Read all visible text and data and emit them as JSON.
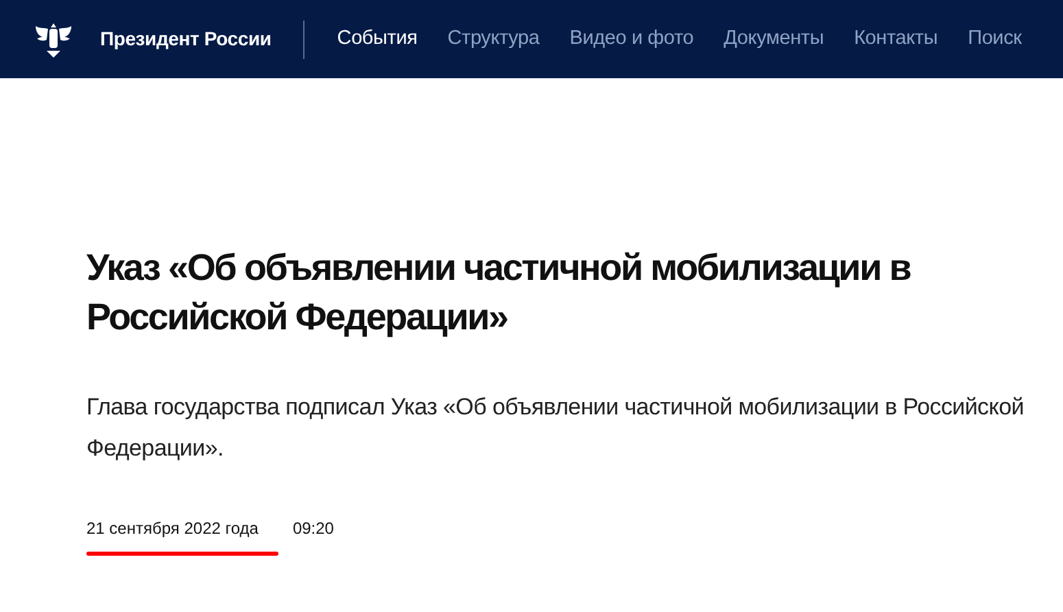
{
  "header": {
    "site_title": "Президент России",
    "nav": [
      {
        "label": "События",
        "selected": true
      },
      {
        "label": "Структура",
        "selected": false
      },
      {
        "label": "Видео и фото",
        "selected": false
      },
      {
        "label": "Документы",
        "selected": false
      },
      {
        "label": "Контакты",
        "selected": false
      },
      {
        "label": "Поиск",
        "selected": false
      }
    ]
  },
  "article": {
    "title": "Указ «Об объявлении частичной мобилизации в Российской Федерации»",
    "lead": "Глава государства подписал Указ «Об объявлении частичной мобилизации в Российской Федерации».",
    "date": "21 сентября 2022 года",
    "time": "09:20"
  }
}
